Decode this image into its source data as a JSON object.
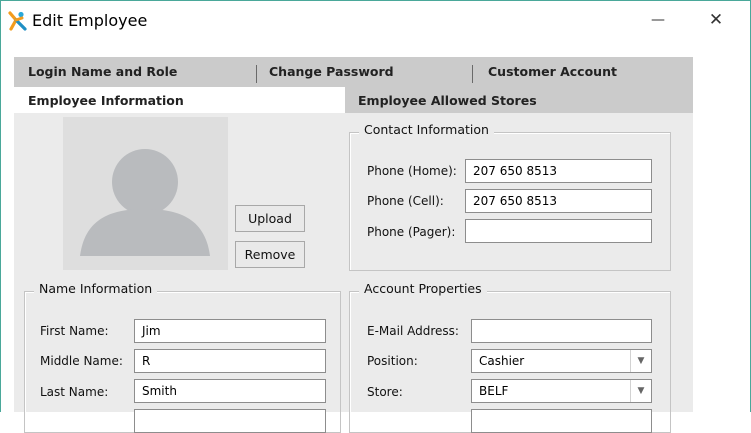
{
  "window": {
    "title": "Edit Employee",
    "minimize_glyph": "—",
    "close_glyph": "✕"
  },
  "tabs": {
    "row1": [
      "Login Name and Role",
      "Change Password",
      "Customer Account"
    ],
    "row2": [
      "Employee Information",
      "Employee Allowed Stores"
    ],
    "active": "Employee Information"
  },
  "photo": {
    "upload_label": "Upload",
    "remove_label": "Remove"
  },
  "contact": {
    "title": "Contact Information",
    "phone_home_label": "Phone (Home):",
    "phone_home_value": "207 650 8513",
    "phone_cell_label": "Phone (Cell):",
    "phone_cell_value": "207 650 8513",
    "phone_pager_label": "Phone (Pager):",
    "phone_pager_value": ""
  },
  "name_info": {
    "title": "Name Information",
    "first_label": "First Name:",
    "first_value": "Jim",
    "middle_label": "Middle Name:",
    "middle_value": "R",
    "last_label": "Last Name:",
    "last_value": "Smith"
  },
  "account": {
    "title": "Account Properties",
    "email_label": "E-Mail Address:",
    "email_value": "",
    "position_label": "Position:",
    "position_value": "Cashier",
    "store_label": "Store:",
    "store_value": "BELF"
  },
  "colors": {
    "accent_border": "#4aa89a",
    "tab_strip": "#cbcbcb",
    "panel": "#ebebeb"
  },
  "icons": {
    "app": "employee-app-icon",
    "avatar": "person-placeholder-icon",
    "dropdown": "chevron-down-icon"
  }
}
